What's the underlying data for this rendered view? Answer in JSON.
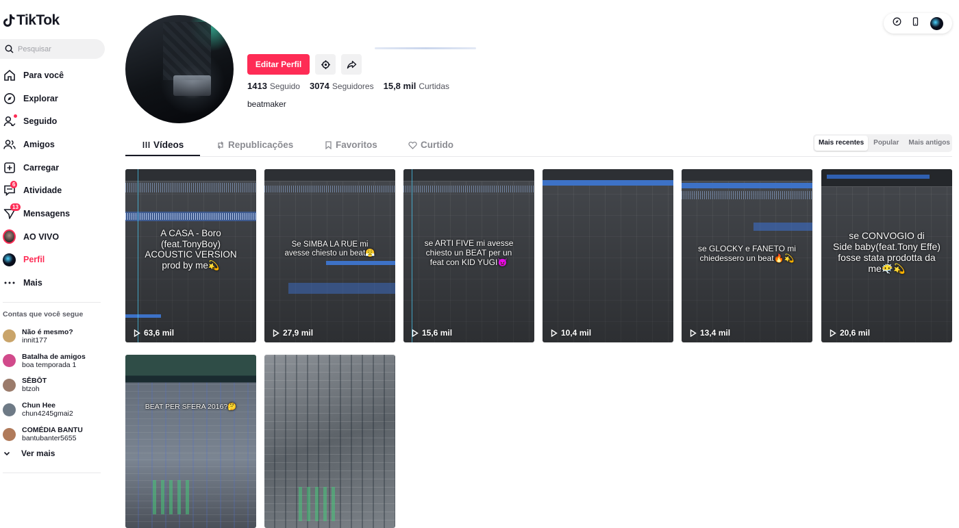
{
  "app": {
    "logo_text": "TikTok"
  },
  "search": {
    "placeholder": "Pesquisar"
  },
  "nav": [
    {
      "label": "Para você",
      "icon": "home-icon"
    },
    {
      "label": "Explorar",
      "icon": "compass-icon"
    },
    {
      "label": "Seguido",
      "icon": "following-icon"
    },
    {
      "label": "Amigos",
      "icon": "friends-icon"
    },
    {
      "label": "Carregar",
      "icon": "upload-icon"
    },
    {
      "label": "Atividade",
      "icon": "activity-icon",
      "badge": "6"
    },
    {
      "label": "Mensagens",
      "icon": "messages-icon",
      "badge": "13"
    },
    {
      "label": "AO VIVO",
      "icon": "live-avatar"
    },
    {
      "label": "Perfil",
      "icon": "profile-avatar",
      "active": true
    },
    {
      "label": "Mais",
      "icon": "more-icon"
    }
  ],
  "following": {
    "title": "Contas que você segue",
    "accounts": [
      {
        "name": "Não é mesmo?",
        "user": "innit177",
        "color": "#c9a46a"
      },
      {
        "name": "Batalha de amigos",
        "user": "boa temporada 1",
        "color": "#d14a8b"
      },
      {
        "name": "SĒBŌT",
        "user": "btzoh",
        "color": "#9b7b6b"
      },
      {
        "name": "Chun Hee",
        "user": "chun4245gmai2",
        "color": "#6e7a86"
      },
      {
        "name": "COMÉDIA BANTU",
        "user": "bantubanter5655",
        "color": "#b07a5a"
      }
    ],
    "see_more": "Ver mais"
  },
  "profile": {
    "edit_label": "Editar Perfil",
    "stats": [
      {
        "value": "1413",
        "label": "Seguido"
      },
      {
        "value": "3074",
        "label": "Seguidores"
      },
      {
        "value": "15,8 mil",
        "label": "Curtidas"
      }
    ],
    "bio": "beatmaker"
  },
  "tabs": [
    {
      "label": "Vídeos",
      "icon": "grid-icon",
      "active": true
    },
    {
      "label": "Republicações",
      "icon": "repost-icon"
    },
    {
      "label": "Favoritos",
      "icon": "bookmark-icon"
    },
    {
      "label": "Curtido",
      "icon": "liked-icon"
    }
  ],
  "sort": [
    "Mais recentes",
    "Popular",
    "Mais antigos"
  ],
  "videos": [
    {
      "caption": "A CASA - Boro\n(feat.TonyBoy)\nACOUSTIC VERSION\nprod by me💫",
      "views": "63,6 mil"
    },
    {
      "caption": "Se SIMBA LA RUE mi\navesse chiesto un beat😤",
      "views": "27,9 mil"
    },
    {
      "caption": "se ARTI FIVE mi avesse\nchiesto un BEAT per un\nfeat con KID YUGI👿",
      "views": "15,6 mil"
    },
    {
      "caption": "",
      "views": "10,4 mil"
    },
    {
      "caption": "se GLOCKY e FANETO mi\nchiedessero un beat🔥💫",
      "views": "13,4 mil"
    },
    {
      "caption": "se CONVOGIO di\nSide baby(feat.Tony Effe)\nfosse stata prodotta da\nme😶‍🌫️💫",
      "views": "20,6 mil"
    },
    {
      "caption": "BEAT PER SFERA 2016?🤔",
      "views": ""
    },
    {
      "caption": "",
      "views": ""
    }
  ]
}
